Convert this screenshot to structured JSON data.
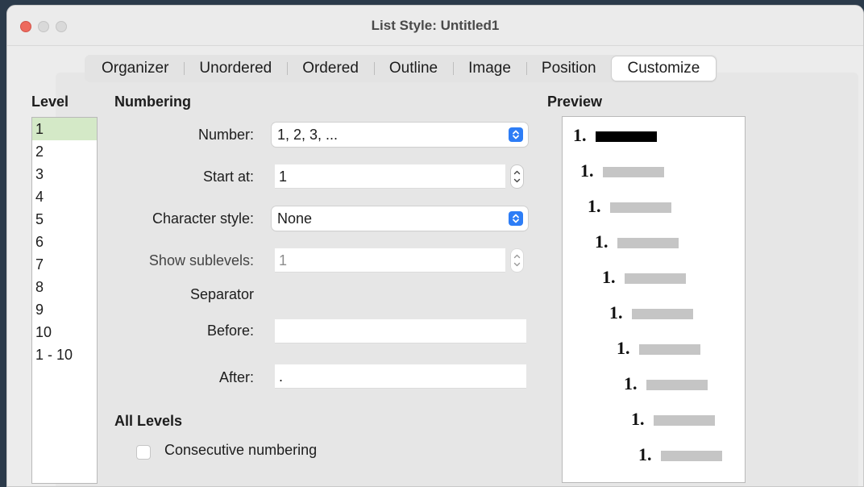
{
  "window": {
    "title": "List Style: Untitled1"
  },
  "tabs": [
    {
      "label": "Organizer"
    },
    {
      "label": "Unordered"
    },
    {
      "label": "Ordered"
    },
    {
      "label": "Outline"
    },
    {
      "label": "Image"
    },
    {
      "label": "Position"
    },
    {
      "label": "Customize",
      "active": true
    }
  ],
  "level": {
    "heading": "Level",
    "items": [
      "1",
      "2",
      "3",
      "4",
      "5",
      "6",
      "7",
      "8",
      "9",
      "10",
      "1 - 10"
    ],
    "selected": "1"
  },
  "numbering": {
    "heading": "Numbering",
    "number_label": "Number:",
    "number_value": "1, 2, 3, ...",
    "start_label": "Start at:",
    "start_value": "1",
    "char_style_label": "Character style:",
    "char_style_value": "None",
    "sublevels_label": "Show sublevels:",
    "sublevels_value": "1",
    "separator_label": "Separator",
    "before_label": "Before:",
    "before_value": "",
    "after_label": "After:",
    "after_value": "."
  },
  "all_levels": {
    "heading": "All Levels",
    "consecutive_label": "Consecutive numbering",
    "consecutive_checked": false
  },
  "preview": {
    "heading": "Preview",
    "items": [
      "1.",
      "1.",
      "1.",
      "1.",
      "1.",
      "1.",
      "1.",
      "1.",
      "1.",
      "1."
    ]
  },
  "colors": {
    "selected_level": "#d4e9c7",
    "accent": "#2d7df6",
    "close_button": "#ed6a5e"
  }
}
